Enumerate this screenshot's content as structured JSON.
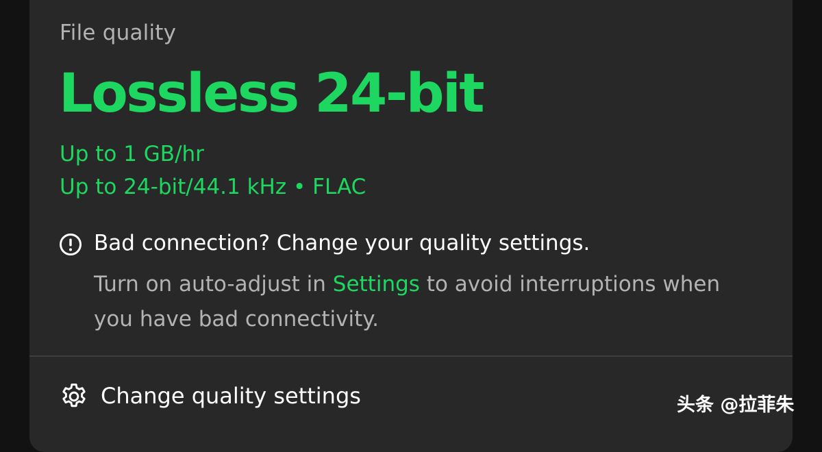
{
  "card": {
    "label": "File quality",
    "title": "Lossless 24-bit",
    "specs": [
      "Up to 1 GB/hr",
      "Up to 24-bit/44.1 kHz • FLAC"
    ]
  },
  "notice": {
    "icon": "exclamation-circle-icon",
    "heading": "Bad connection? Change your quality settings.",
    "body_before": "Turn on auto-adjust in ",
    "body_link": "Settings",
    "body_after": " to avoid interruptions when you have bad connectivity."
  },
  "action": {
    "icon": "gear-icon",
    "label": "Change quality settings"
  },
  "watermark": {
    "text": "头条 @拉菲朱"
  },
  "colors": {
    "accent": "#1ed760",
    "card_background": "#282828",
    "page_background": "#121212",
    "primary_text": "#ffffff",
    "secondary_text": "#b3b3b3"
  }
}
